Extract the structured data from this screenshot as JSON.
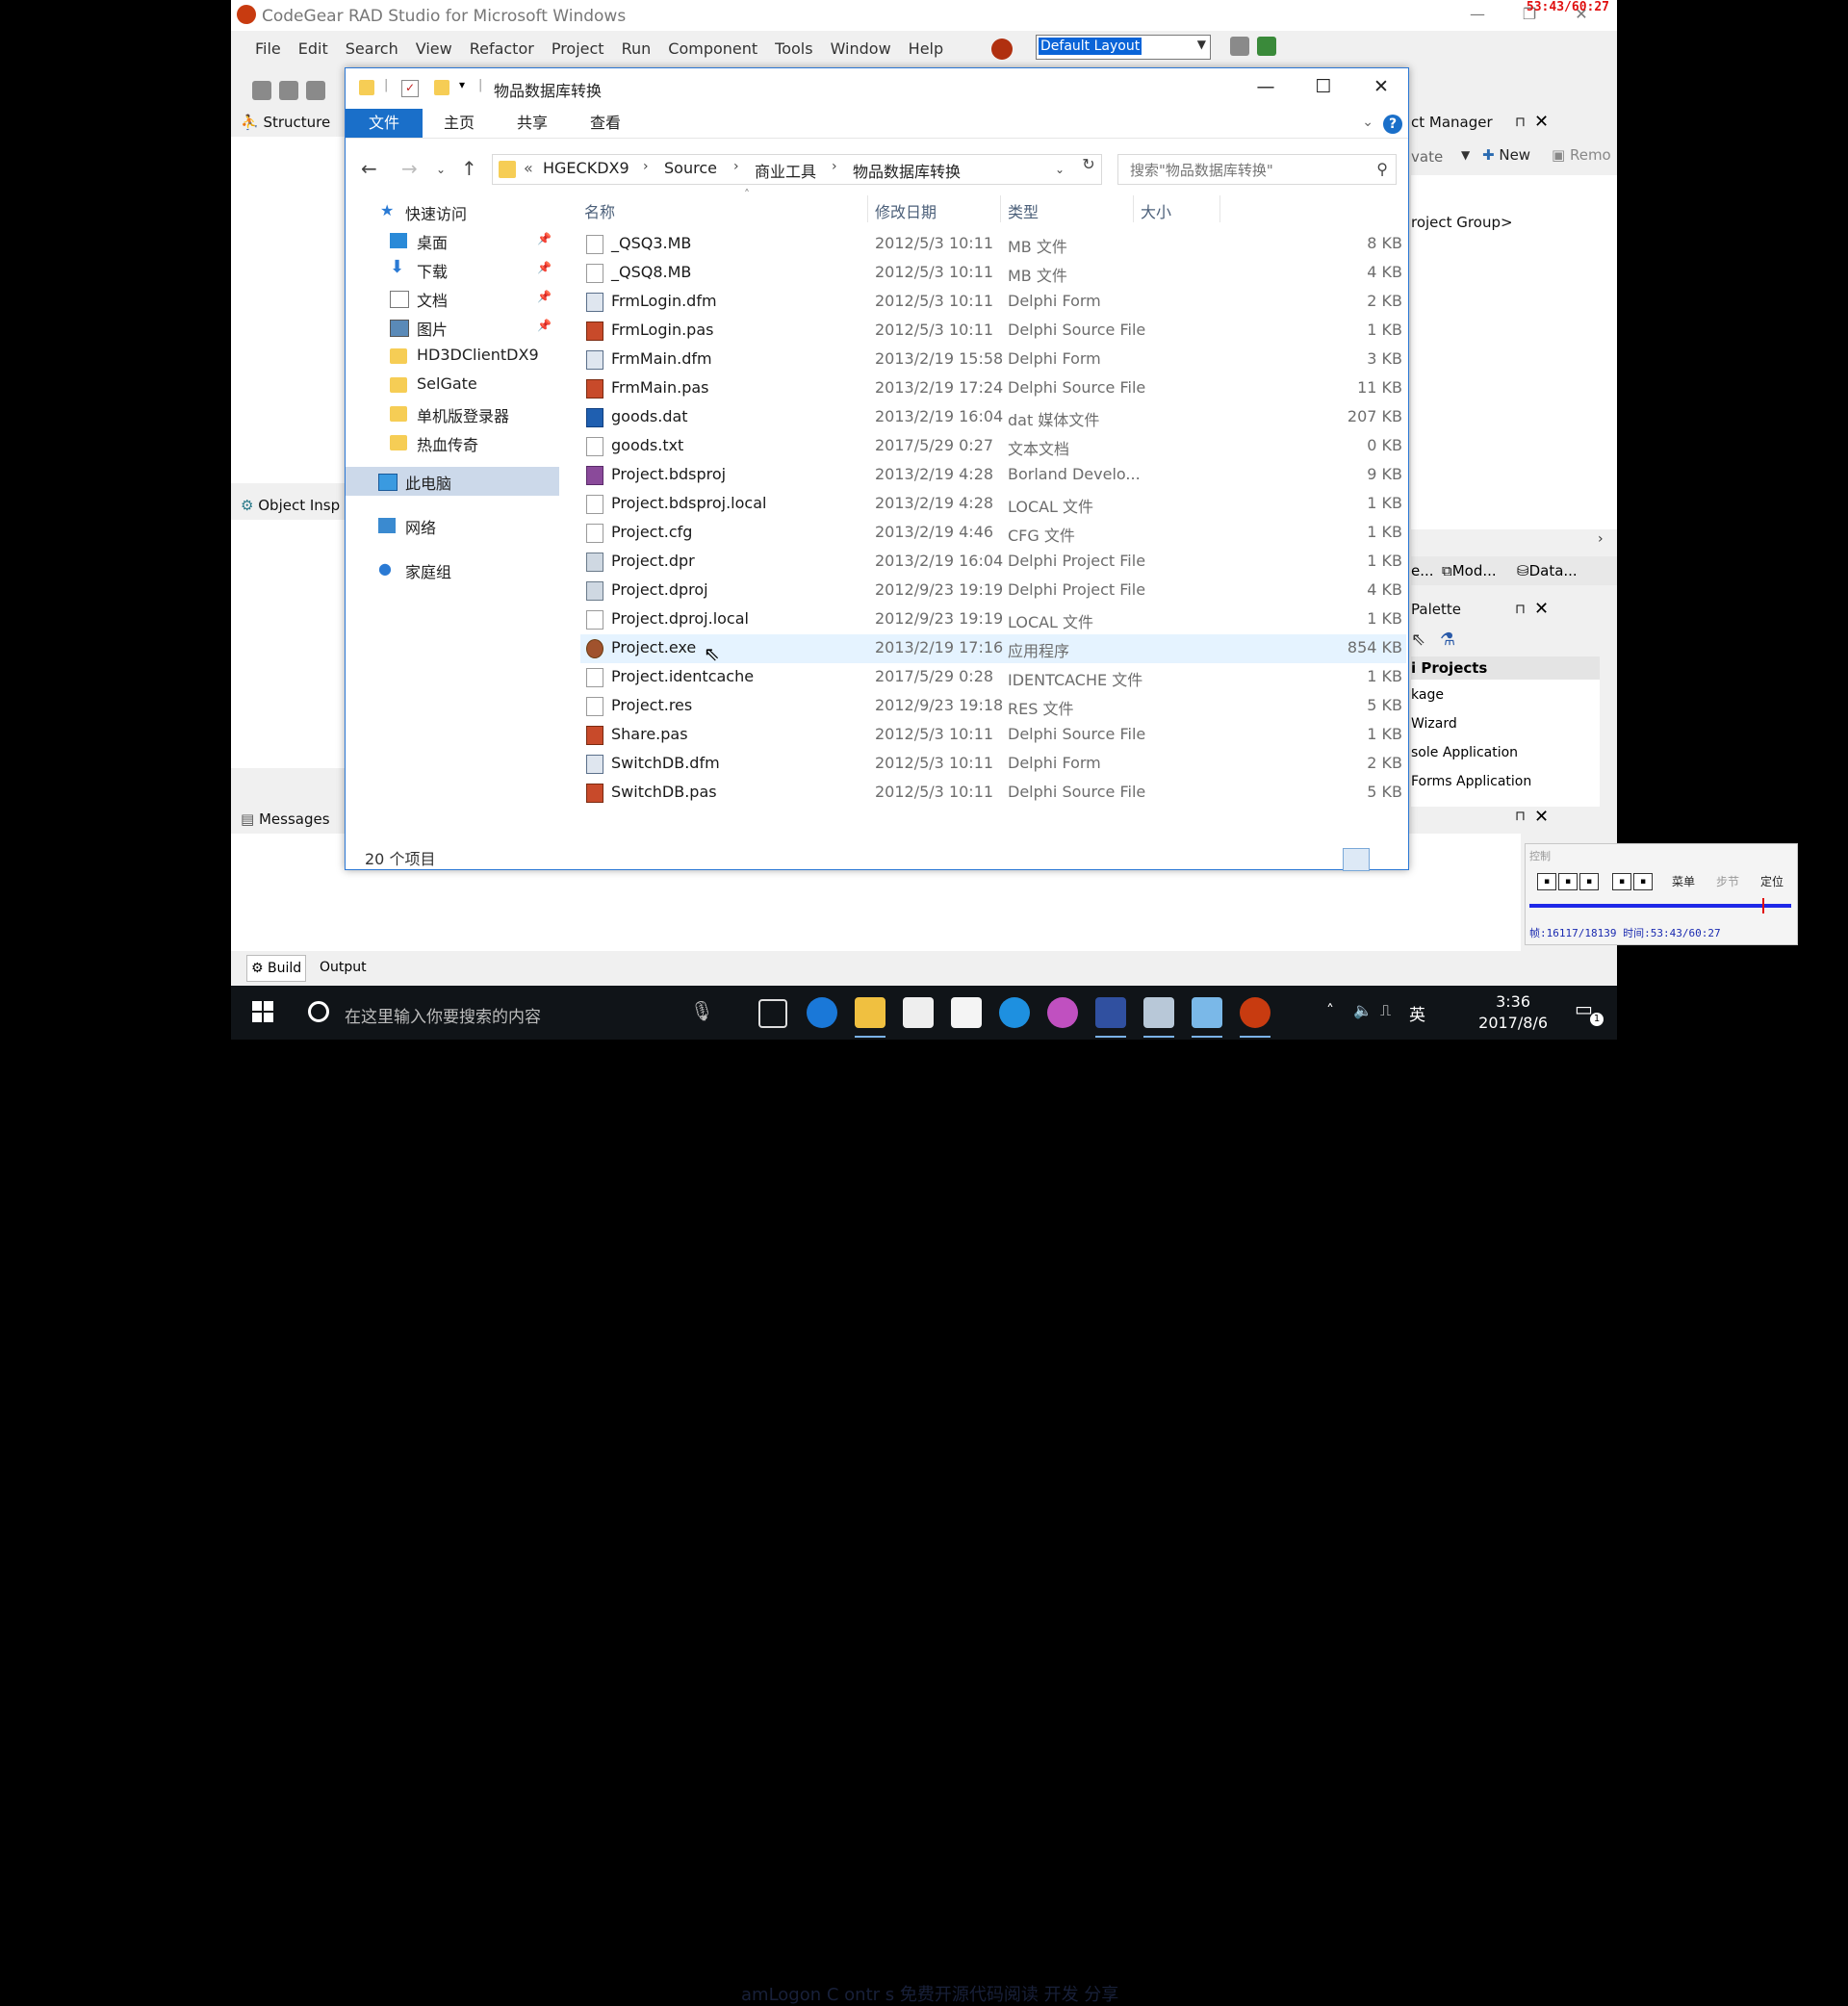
{
  "ide": {
    "title": "CodeGear RAD Studio for Microsoft Windows",
    "overlay_timer": "53:43/60:27",
    "menu": [
      "File",
      "Edit",
      "Search",
      "View",
      "Refactor",
      "Project",
      "Run",
      "Component",
      "Tools",
      "Window",
      "Help"
    ],
    "layout_combo": "Default Layout",
    "structure_label": "Structure",
    "object_inspector_label": "Object Insp",
    "messages_label": "Messages",
    "build_tab": "Build",
    "output_tab": "Output",
    "project_manager": {
      "title": "ct Manager",
      "activate": "vate",
      "new": "New",
      "remove": "Remo",
      "tree_root": "roject Group>"
    },
    "side_tabs": [
      "e...",
      "Mod...",
      "Data..."
    ],
    "palette": {
      "title": "Palette",
      "group": "i Projects",
      "items": [
        "kage",
        "Wizard",
        "sole Application",
        "Forms Application"
      ]
    }
  },
  "explorer": {
    "title": "物品数据库转换",
    "ribbon_tabs": [
      "文件",
      "主页",
      "共享",
      "查看"
    ],
    "breadcrumb": [
      "HGECKDX9",
      "Source",
      "商业工具",
      "物品数据库转换"
    ],
    "breadcrumb_prefix": "«",
    "search_placeholder": "搜索\"物品数据库转换\"",
    "nav": {
      "quick_access": "快速访问",
      "pinned": [
        "桌面",
        "下载",
        "文档",
        "图片"
      ],
      "folders": [
        "HD3DClientDX9",
        "SelGate",
        "单机版登录器",
        "热血传奇"
      ],
      "this_pc": "此电脑",
      "network": "网络",
      "homegroup": "家庭组"
    },
    "columns": [
      "名称",
      "修改日期",
      "类型",
      "大小"
    ],
    "files": [
      {
        "name": "_QSQ3.MB",
        "date": "2012/5/3 10:11",
        "type": "MB 文件",
        "size": "8 KB",
        "icon": "file-icon"
      },
      {
        "name": "_QSQ8.MB",
        "date": "2012/5/3 10:11",
        "type": "MB 文件",
        "size": "4 KB",
        "icon": "file-icon"
      },
      {
        "name": "FrmLogin.dfm",
        "date": "2012/5/3 10:11",
        "type": "Delphi Form",
        "size": "2 KB",
        "icon": "dfm-icon"
      },
      {
        "name": "FrmLogin.pas",
        "date": "2012/5/3 10:11",
        "type": "Delphi Source File",
        "size": "1 KB",
        "icon": "pas-icon"
      },
      {
        "name": "FrmMain.dfm",
        "date": "2013/2/19 15:58",
        "type": "Delphi Form",
        "size": "3 KB",
        "icon": "dfm-icon"
      },
      {
        "name": "FrmMain.pas",
        "date": "2013/2/19 17:24",
        "type": "Delphi Source File",
        "size": "11 KB",
        "icon": "pas-icon"
      },
      {
        "name": "goods.dat",
        "date": "2013/2/19 16:04",
        "type": "dat 媒体文件",
        "size": "207 KB",
        "icon": "dat-icon"
      },
      {
        "name": "goods.txt",
        "date": "2017/5/29 0:27",
        "type": "文本文档",
        "size": "0 KB",
        "icon": "file-icon"
      },
      {
        "name": "Project.bdsproj",
        "date": "2013/2/19 4:28",
        "type": "Borland Develo...",
        "size": "9 KB",
        "icon": "bds-icon"
      },
      {
        "name": "Project.bdsproj.local",
        "date": "2013/2/19 4:28",
        "type": "LOCAL 文件",
        "size": "1 KB",
        "icon": "file-icon"
      },
      {
        "name": "Project.cfg",
        "date": "2013/2/19 4:46",
        "type": "CFG 文件",
        "size": "1 KB",
        "icon": "file-icon"
      },
      {
        "name": "Project.dpr",
        "date": "2013/2/19 16:04",
        "type": "Delphi Project File",
        "size": "1 KB",
        "icon": "dpr-icon"
      },
      {
        "name": "Project.dproj",
        "date": "2012/9/23 19:19",
        "type": "Delphi Project File",
        "size": "4 KB",
        "icon": "dpr-icon"
      },
      {
        "name": "Project.dproj.local",
        "date": "2012/9/23 19:19",
        "type": "LOCAL 文件",
        "size": "1 KB",
        "icon": "file-icon"
      },
      {
        "name": "Project.exe",
        "date": "2013/2/19 17:16",
        "type": "应用程序",
        "size": "854 KB",
        "icon": "exe-icon"
      },
      {
        "name": "Project.identcache",
        "date": "2017/5/29 0:28",
        "type": "IDENTCACHE 文件",
        "size": "1 KB",
        "icon": "file-icon"
      },
      {
        "name": "Project.res",
        "date": "2012/9/23 19:18",
        "type": "RES 文件",
        "size": "5 KB",
        "icon": "file-icon"
      },
      {
        "name": "Share.pas",
        "date": "2012/5/3 10:11",
        "type": "Delphi Source File",
        "size": "1 KB",
        "icon": "pas-icon"
      },
      {
        "name": "SwitchDB.dfm",
        "date": "2012/5/3 10:11",
        "type": "Delphi Form",
        "size": "2 KB",
        "icon": "dfm-icon"
      },
      {
        "name": "SwitchDB.pas",
        "date": "2012/5/3 10:11",
        "type": "Delphi Source File",
        "size": "5 KB",
        "icon": "pas-icon"
      }
    ],
    "hovered_file": "Project.exe",
    "status_count": "20 个项目"
  },
  "player": {
    "label": "控制",
    "menu": "菜单",
    "step": "步节",
    "locate": "定位",
    "status": "帧:16117/18139 时间:53:43/60:27",
    "progress": 0.89
  },
  "taskbar": {
    "search_placeholder": "在这里输入你要搜索的内容",
    "time": "3:36",
    "date": "2017/8/6",
    "ime": "英",
    "notification_count": "1",
    "behind_text": "amLogon C  ontr  s 免费开源代码阅读 开发 分享"
  },
  "colors": {
    "accent": "#1a6fc9",
    "selection": "#ccd9ea",
    "hover_row": "#e5f3ff",
    "taskbar": "#101418"
  }
}
